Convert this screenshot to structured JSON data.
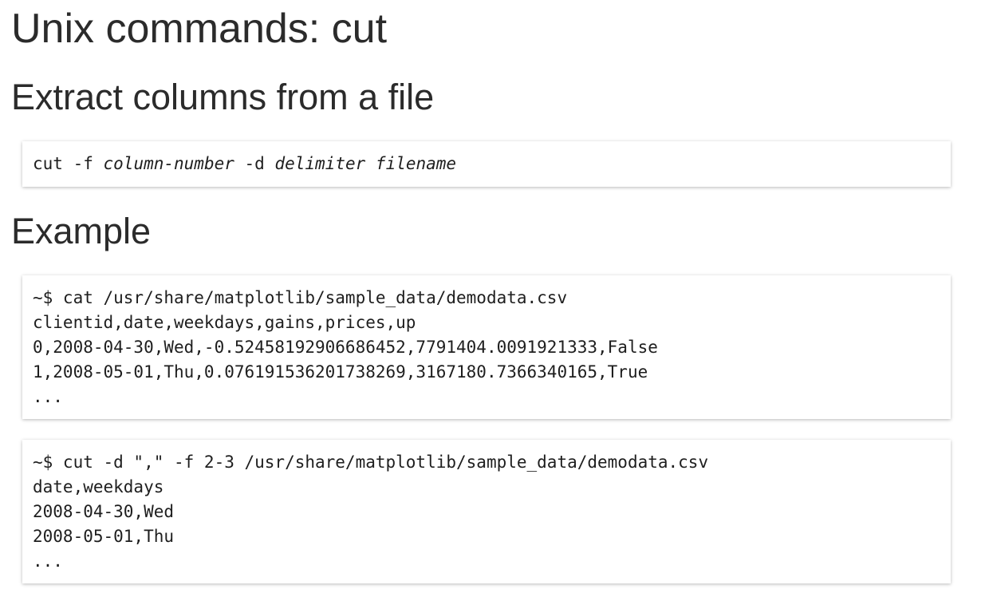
{
  "title": "Unix commands: cut",
  "sections": {
    "extract": {
      "heading": "Extract columns from a file",
      "syntax": {
        "cmd": "cut -f ",
        "arg1": "column-number",
        "mid": " -d ",
        "arg2": "delimiter",
        "space": " ",
        "arg3": "filename"
      }
    },
    "example": {
      "heading": "Example",
      "block1": {
        "lines": [
          "~$ cat /usr/share/matplotlib/sample_data/demodata.csv",
          "clientid,date,weekdays,gains,prices,up",
          "0,2008-04-30,Wed,-0.52458192906686452,7791404.0091921333,False",
          "1,2008-05-01,Thu,0.076191536201738269,3167180.7366340165,True",
          "..."
        ]
      },
      "block2": {
        "lines": [
          "~$ cut -d \",\" -f 2-3 /usr/share/matplotlib/sample_data/demodata.csv",
          "date,weekdays",
          "2008-04-30,Wed",
          "2008-05-01,Thu",
          "..."
        ]
      }
    }
  }
}
